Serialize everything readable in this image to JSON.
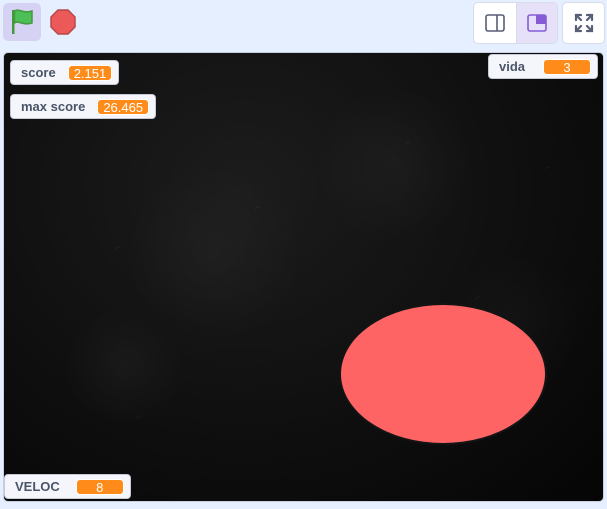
{
  "toolbar": {
    "green_flag_icon": "green-flag-icon",
    "stop_icon": "stop-icon",
    "layout_small_icon": "small-stage-icon",
    "layout_normal_icon": "normal-stage-icon",
    "fullscreen_icon": "fullscreen-icon"
  },
  "monitors": {
    "score": {
      "label": "score",
      "value": "2.151"
    },
    "max_score": {
      "label": "max score",
      "value": "26.465"
    },
    "vida": {
      "label": "vida",
      "value": "3"
    },
    "veloc": {
      "label": "VELOC",
      "value": "8"
    }
  },
  "sprite": {
    "name": "ball",
    "color": "#ff6464"
  },
  "colors": {
    "flag_green": "#4cbf56",
    "stop_red": "#ec5959",
    "monitor_orange": "#ff8c1a",
    "active_toggle": "#e6e0f8"
  }
}
